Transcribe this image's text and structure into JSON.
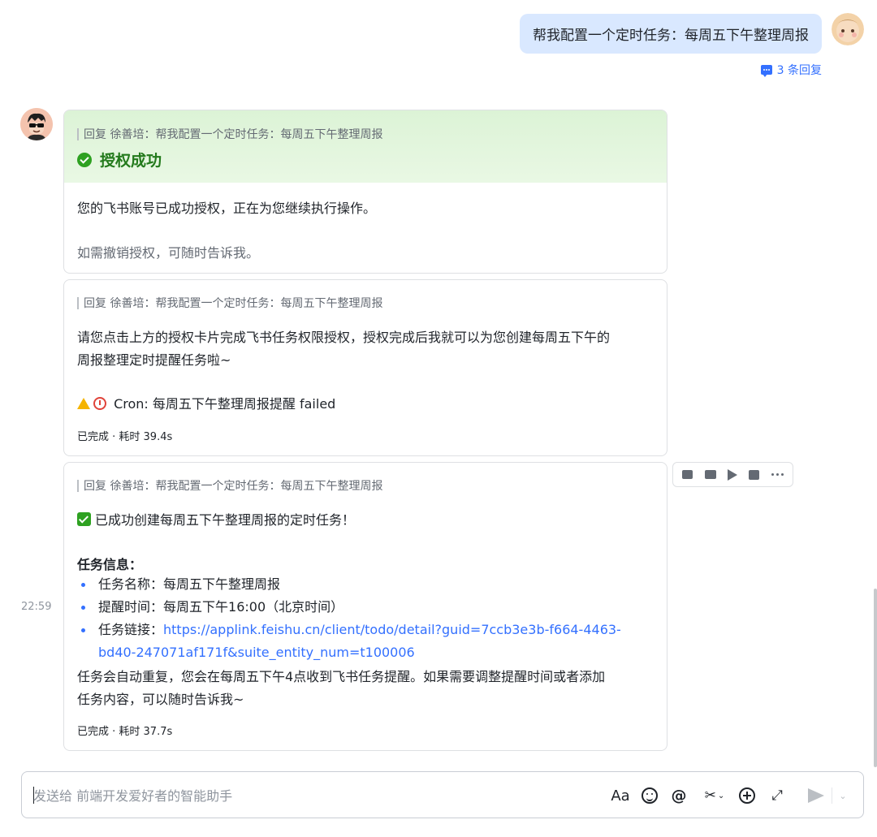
{
  "user_message": {
    "text": "帮我配置一个定时任务：每周五下午整理周报",
    "reply_count_label": "3 条回复"
  },
  "messages": [
    {
      "quote": "回复 徐善培：帮我配置一个定时任务：每周五下午整理周报",
      "success_title": "授权成功",
      "line1": "您的飞书账号已成功授权，正在为您继续执行操作。",
      "line2": "如需撤销授权，可随时告诉我。"
    },
    {
      "quote": "回复 徐善培：帮我配置一个定时任务：每周五下午整理周报",
      "line1": "请您点击上方的授权卡片完成飞书任务权限授权，授权完成后我就可以为您创建每周五下午的",
      "line2": "周报整理定时提醒任务啦~",
      "cron_status": "Cron: 每周五下午整理周报提醒 failed",
      "meta": "已完成 · 耗时 39.4s"
    },
    {
      "quote": "回复 徐善培：帮我配置一个定时任务：每周五下午整理周报",
      "headline": "已成功创建每周五下午整理周报的定时任务！",
      "section_title": "任务信息：",
      "items": [
        {
          "label": "任务名称：",
          "value": "每周五下午整理周报"
        },
        {
          "label": "提醒时间：",
          "value": "每周五下午16:00（北京时间）"
        },
        {
          "label": "任务链接：",
          "value": "https://applink.feishu.cn/client/todo/detail?guid=7ccb3e3b-f664-4463-",
          "value_cont": "bd40-247071af171f&suite_entity_num=t100006"
        }
      ],
      "footer_line1": "任务会自动重复，您会在每周五下午4点收到飞书任务提醒。如果需要调整提醒时间或者添加",
      "footer_line2": "任务内容，可以随时告诉我~",
      "meta": "已完成 · 耗时 37.7s",
      "timestamp": "22:59"
    }
  ],
  "hover_actions": [
    "like-icon",
    "comment-icon",
    "forward-icon",
    "save-icon",
    "more-icon"
  ],
  "composer": {
    "placeholder": "发送给 前端开发爱好者的智能助手",
    "font_label": "Aa"
  },
  "colors": {
    "accent": "#3370ff",
    "user_bubble": "#d9e8ff",
    "success_green": "#2ea121",
    "success_header_bg": "#dcf3d6"
  }
}
